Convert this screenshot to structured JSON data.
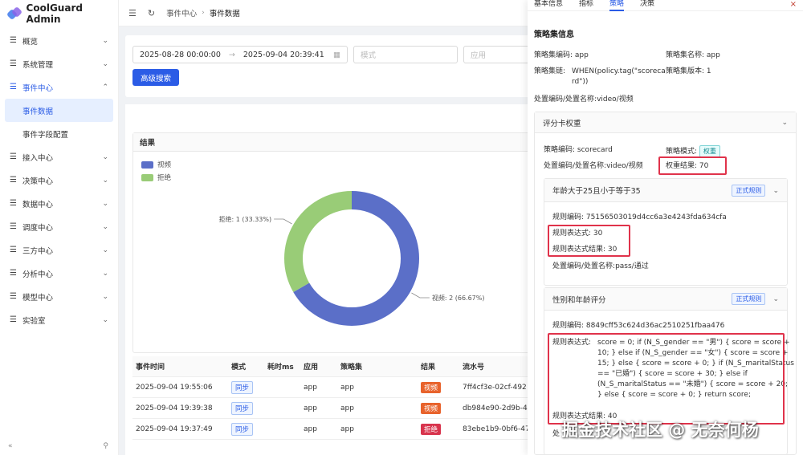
{
  "app": {
    "title": "CoolGuard Admin"
  },
  "sidebar": {
    "items": [
      {
        "label": "概览",
        "expanded": false
      },
      {
        "label": "系统管理",
        "expanded": false
      },
      {
        "label": "事件中心",
        "expanded": true
      },
      {
        "label": "接入中心",
        "expanded": false
      },
      {
        "label": "决策中心",
        "expanded": false
      },
      {
        "label": "数据中心",
        "expanded": false
      },
      {
        "label": "调度中心",
        "expanded": false
      },
      {
        "label": "三方中心",
        "expanded": false
      },
      {
        "label": "分析中心",
        "expanded": false
      },
      {
        "label": "模型中心",
        "expanded": false
      },
      {
        "label": "实验室",
        "expanded": false
      }
    ],
    "sub_items": [
      "事件数据",
      "事件字段配置"
    ],
    "collapse_glyph": "«",
    "pin_glyph": "⚲"
  },
  "header": {
    "breadcrumb": [
      "事件中心",
      "事件数据"
    ]
  },
  "filter": {
    "date_start": "2025-08-28 00:00:00",
    "date_end": "2025-09-04 20:39:41",
    "mode_placeholder": "模式",
    "app_placeholder": "应用",
    "advanced_search": "高级搜索"
  },
  "results": {
    "title": "结果"
  },
  "chart_data": {
    "type": "pie",
    "categories": [
      "视频",
      "拒绝"
    ],
    "values": [
      2,
      1
    ],
    "percents": [
      66.67,
      33.33
    ],
    "labels": [
      "视频: 2 (66.67%)",
      "拒绝: 1 (33.33%)"
    ],
    "colors": [
      "#5b6fc8",
      "#99cc77"
    ],
    "legend_position": "top-left",
    "donut": true
  },
  "table": {
    "headers": [
      "事件时间",
      "模式",
      "耗时ms",
      "应用",
      "策略集",
      "结果",
      "流水号"
    ],
    "rows": [
      {
        "time": "2025-09-04 19:55:06",
        "mode": "同步",
        "cost": "",
        "app": "app",
        "policy_set": "app",
        "result": "视频",
        "result_color": "#e8632c",
        "serial": "7ff4cf3e-02cf-492"
      },
      {
        "time": "2025-09-04 19:39:38",
        "mode": "同步",
        "cost": "",
        "app": "app",
        "policy_set": "app",
        "result": "视频",
        "result_color": "#e8632c",
        "serial": "db984e90-2d9b-4"
      },
      {
        "time": "2025-09-04 19:37:49",
        "mode": "同步",
        "cost": "",
        "app": "app",
        "policy_set": "app",
        "result": "拒绝",
        "result_color": "#d8344d",
        "serial": "83ebe1b9-0bf6-47"
      }
    ]
  },
  "drawer": {
    "tabs": [
      "基本信息",
      "指标",
      "策略",
      "决策"
    ],
    "active_tab": 2,
    "close_glyph": "×",
    "section_title": "策略集信息",
    "policy_set_code_label": "策略集编码:",
    "policy_set_code": "app",
    "policy_set_name_label": "策略集名称:",
    "policy_set_name": "app",
    "policy_chain_label": "策略集链:",
    "policy_chain_line1": "WHEN(policy.tag(\"scoreca",
    "policy_chain_line2": "rd\"))",
    "policy_version_label": "策略集版本:",
    "policy_version": "1",
    "disposal_label": "处置编码/处置名称:",
    "disposal": "video/视频",
    "scorecard": {
      "title": "评分卡权重",
      "policy_code_label": "策略编码:",
      "policy_code": "scorecard",
      "policy_mode_label": "策略模式:",
      "policy_mode": "权重",
      "disposal_label": "处置编码/处置名称:",
      "disposal": "video/视频",
      "weight_result_label": "权重结果:",
      "weight_result": "70"
    },
    "rule1": {
      "title": "年龄大于25且小于等于35",
      "tag": "正式规则",
      "code_label": "规则编码:",
      "code": "75156503019d4cc6a3e4243fda634cfa",
      "expr_label": "规则表达式:",
      "expr": "30",
      "expr_result_label": "规则表达式结果:",
      "expr_result": "30",
      "disposal_label": "处置编码/处置名称:",
      "disposal": "pass/通过"
    },
    "rule2": {
      "title": "性别和年龄评分",
      "tag": "正式规则",
      "code_label": "规则编码:",
      "code": "8849cff53c624d36ac2510251fbaa476",
      "expr_label": "规则表达式:",
      "expr_lines": [
        "score = 0; if (N_S_gender == \"男\") { score = score +",
        "10; } else if (N_S_gender == \"女\") { score = score +",
        "15; } else { score = score + 0; } if (N_S_maritalStatus",
        "== \"已婚\") { score = score + 30; } else if",
        "(N_S_maritalStatus == \"未婚\") { score = score + 20;",
        "} else { score = score + 0; } return score;"
      ],
      "expr_result_label": "规则表达式结果:",
      "expr_result": "40",
      "disposal_label_partial": "处"
    }
  },
  "watermark": "掘金技术社区 @ 无奈何杨"
}
